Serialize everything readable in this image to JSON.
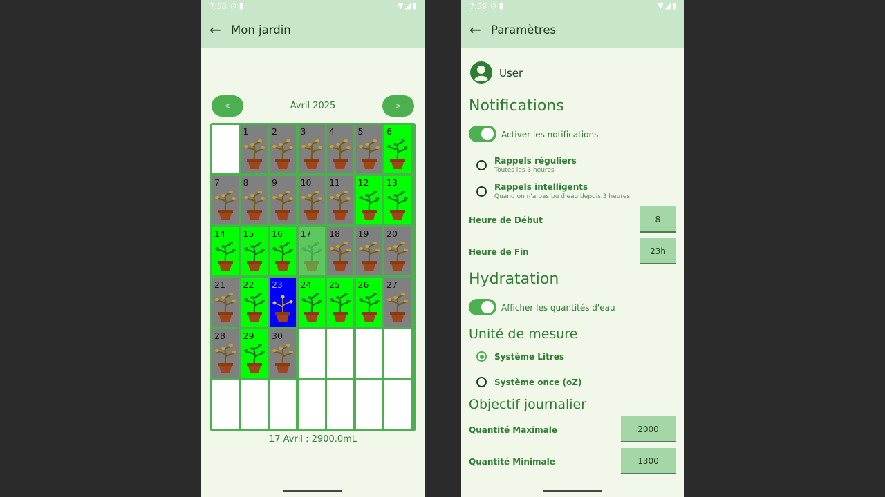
{
  "phone1": {
    "status": {
      "time": "7:58"
    },
    "appbar": {
      "title": "Mon jardin"
    },
    "calendar": {
      "prev_label": "<",
      "next_label": ">",
      "month_label": "Avril 2025",
      "summary": "17 Avril : 2900.0mL",
      "cells": [
        {
          "num": "",
          "state": "empty"
        },
        {
          "num": "1",
          "state": "gray"
        },
        {
          "num": "2",
          "state": "gray"
        },
        {
          "num": "3",
          "state": "gray"
        },
        {
          "num": "4",
          "state": "gray"
        },
        {
          "num": "5",
          "state": "gray"
        },
        {
          "num": "6",
          "state": "green"
        },
        {
          "num": "7",
          "state": "gray"
        },
        {
          "num": "8",
          "state": "gray"
        },
        {
          "num": "9",
          "state": "gray"
        },
        {
          "num": "10",
          "state": "gray"
        },
        {
          "num": "11",
          "state": "gray"
        },
        {
          "num": "12",
          "state": "green"
        },
        {
          "num": "13",
          "state": "green"
        },
        {
          "num": "14",
          "state": "green"
        },
        {
          "num": "15",
          "state": "green"
        },
        {
          "num": "16",
          "state": "green"
        },
        {
          "num": "17",
          "state": "faded"
        },
        {
          "num": "18",
          "state": "gray"
        },
        {
          "num": "19",
          "state": "gray"
        },
        {
          "num": "20",
          "state": "gray"
        },
        {
          "num": "21",
          "state": "gray"
        },
        {
          "num": "22",
          "state": "green"
        },
        {
          "num": "23",
          "state": "blue"
        },
        {
          "num": "24",
          "state": "green"
        },
        {
          "num": "25",
          "state": "green"
        },
        {
          "num": "26",
          "state": "green"
        },
        {
          "num": "27",
          "state": "gray"
        },
        {
          "num": "28",
          "state": "gray"
        },
        {
          "num": "29",
          "state": "green"
        },
        {
          "num": "30",
          "state": "gray"
        },
        {
          "num": "",
          "state": "empty"
        },
        {
          "num": "",
          "state": "empty"
        },
        {
          "num": "",
          "state": "empty"
        },
        {
          "num": "",
          "state": "empty"
        },
        {
          "num": "",
          "state": "empty"
        },
        {
          "num": "",
          "state": "empty"
        },
        {
          "num": "",
          "state": "empty"
        },
        {
          "num": "",
          "state": "empty"
        },
        {
          "num": "",
          "state": "empty"
        },
        {
          "num": "",
          "state": "empty"
        },
        {
          "num": "",
          "state": "empty"
        }
      ]
    }
  },
  "phone2": {
    "status": {
      "time": "7:59"
    },
    "appbar": {
      "title": "Paramètres"
    },
    "user": {
      "name": "User"
    },
    "notifications": {
      "title": "Notifications",
      "toggle_label": "Activer les notifications",
      "toggle_on": true,
      "options": [
        {
          "label": "Rappels réguliers",
          "desc": "Toutes les 3 heures",
          "checked": false
        },
        {
          "label": "Rappels intelligents",
          "desc": "Quand on n'a pas bu d'eau depuis 3 heures",
          "checked": false
        }
      ],
      "start_label": "Heure de Début",
      "start_value": "8",
      "end_label": "Heure de Fin",
      "end_value": "23h"
    },
    "hydration": {
      "title": "Hydratation",
      "toggle_label": "Afficher les quantités d'eau",
      "toggle_on": true
    },
    "unit": {
      "title": "Unité de mesure",
      "options": [
        {
          "label": "Système Litres",
          "checked": true
        },
        {
          "label": "Système once (oZ)",
          "checked": false
        }
      ]
    },
    "goal": {
      "title": "Objectif journalier",
      "max_label": "Quantité Maximale",
      "max_value": "2000",
      "min_label": "Quantité Minimale",
      "min_value": "1300"
    }
  },
  "colors": {
    "accent": "#4caf50",
    "appbar": "#c8e6c9",
    "background": "#f1f7e9",
    "watered": "#00ff00",
    "dry": "#808080",
    "today": "#0000ff"
  }
}
